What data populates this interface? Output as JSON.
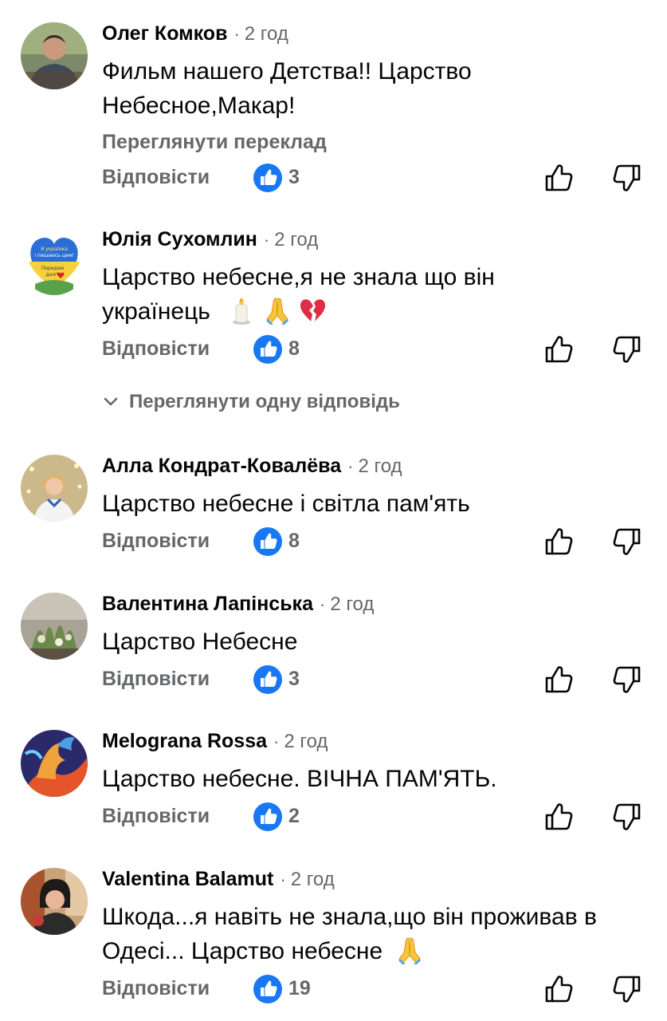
{
  "comments": [
    {
      "author": "Олег Комков",
      "time": "2 год",
      "lines": [
        "Фильм нашего Детства!! Царство",
        "Небесное,Макар!"
      ],
      "translate": "Переглянути переклад",
      "reply": "Відповісти",
      "likes": "3"
    },
    {
      "author": "Юлія Сухомлин",
      "time": "2 год",
      "lines": [
        "Царство небесне,я не знала що він",
        "українець"
      ],
      "reply": "Відповісти",
      "likes": "8",
      "view_replies": "Переглянути одну відповідь",
      "avatar_text": [
        "Я українка",
        "і пишаюсь цим!",
        "Передаю",
        "далі"
      ]
    },
    {
      "author": "Алла Кондрат-Ковалёва",
      "time": "2 год",
      "lines": [
        "Царство небесне і світла пам'ять"
      ],
      "reply": "Відповісти",
      "likes": "8"
    },
    {
      "author": "Валентина Лапінська",
      "time": "2 год",
      "lines": [
        "Царство Небесне"
      ],
      "reply": "Відповісти",
      "likes": "3"
    },
    {
      "author": "Melograna Rossa",
      "time": "2 год",
      "lines": [
        "Царство небесне. ВІЧНА ПАМ'ЯТЬ."
      ],
      "reply": "Відповісти",
      "likes": "2"
    },
    {
      "author": "Valentina  Balamut",
      "time": "2 год",
      "lines": [
        "Шкода...я навіть не знала,що він проживав в",
        "Одесі... Царство небесне"
      ],
      "reply": "Відповісти",
      "likes": "19"
    }
  ],
  "icons": {
    "like_badge": "blue-like-badge-icon",
    "thumb_up": "thumb-up-outline-icon",
    "thumb_down": "thumb-down-outline-icon",
    "chevron": "chevron-down-icon",
    "candle": "candle-emoji",
    "pray": "folded-hands-emoji",
    "heart": "broken-heart-emoji"
  },
  "colors": {
    "accent_blue": "#1877f2",
    "secondary_text": "#65676b",
    "primary_text": "#050505"
  }
}
